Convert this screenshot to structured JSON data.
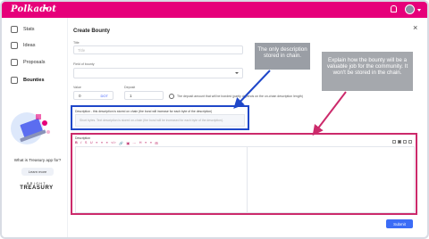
{
  "topbar": {
    "logo_text": "Polkadot",
    "accent_color": "#e6007a",
    "icons": [
      "bell-icon",
      "avatar-icon"
    ]
  },
  "sidebar": {
    "items": [
      {
        "label": "Stats",
        "icon": "stats-icon"
      },
      {
        "label": "Ideas",
        "icon": "ideas-icon"
      },
      {
        "label": "Proposals",
        "icon": "proposals-icon"
      },
      {
        "label": "Bounties",
        "icon": "bounties-icon",
        "active": true
      }
    ],
    "treasury_question": "What is Treasury app for?",
    "learn_more": "Learn more",
    "brand_top": "BRIGHT",
    "brand_bottom": "TREASURY"
  },
  "main": {
    "title": "Create Bounty",
    "title_label": "Title",
    "title_placeholder": "Title",
    "field_of_bounty_label": "Field of bounty",
    "value_label": "Value",
    "value": "0",
    "value_unit": "DOT",
    "deposit_label": "Deposit",
    "deposit_value": "1",
    "deposit_note": "The deposit amount that will be bonded (partly depends on the on-chain description length)",
    "description_label": "Description - this description is stored on chain (the bond will increase for each byte of the description)",
    "description_placeholder": "Short bytes. Text description is stored on-chain (the bond will be increased for each byte of the description).",
    "editor_label": "Description",
    "editor_toolbar": [
      "B",
      "I",
      "S",
      "U",
      "≡",
      "≡",
      "❝",
      "</>",
      "🔗",
      "▣",
      "⋯",
      "H",
      "≡",
      "≡",
      "⊞"
    ],
    "submit_label": "Submit"
  },
  "callouts": {
    "chain": "The only description stored in chain.",
    "community": "Explain how the bounty will be a valuable job for the community. It won't be stored in the chain."
  },
  "colors": {
    "highlight_blue": "#1f47c9",
    "highlight_pink": "#cc2a6b",
    "callout_gray": "#9a9ea5",
    "submit_blue": "#3b6cf6"
  }
}
